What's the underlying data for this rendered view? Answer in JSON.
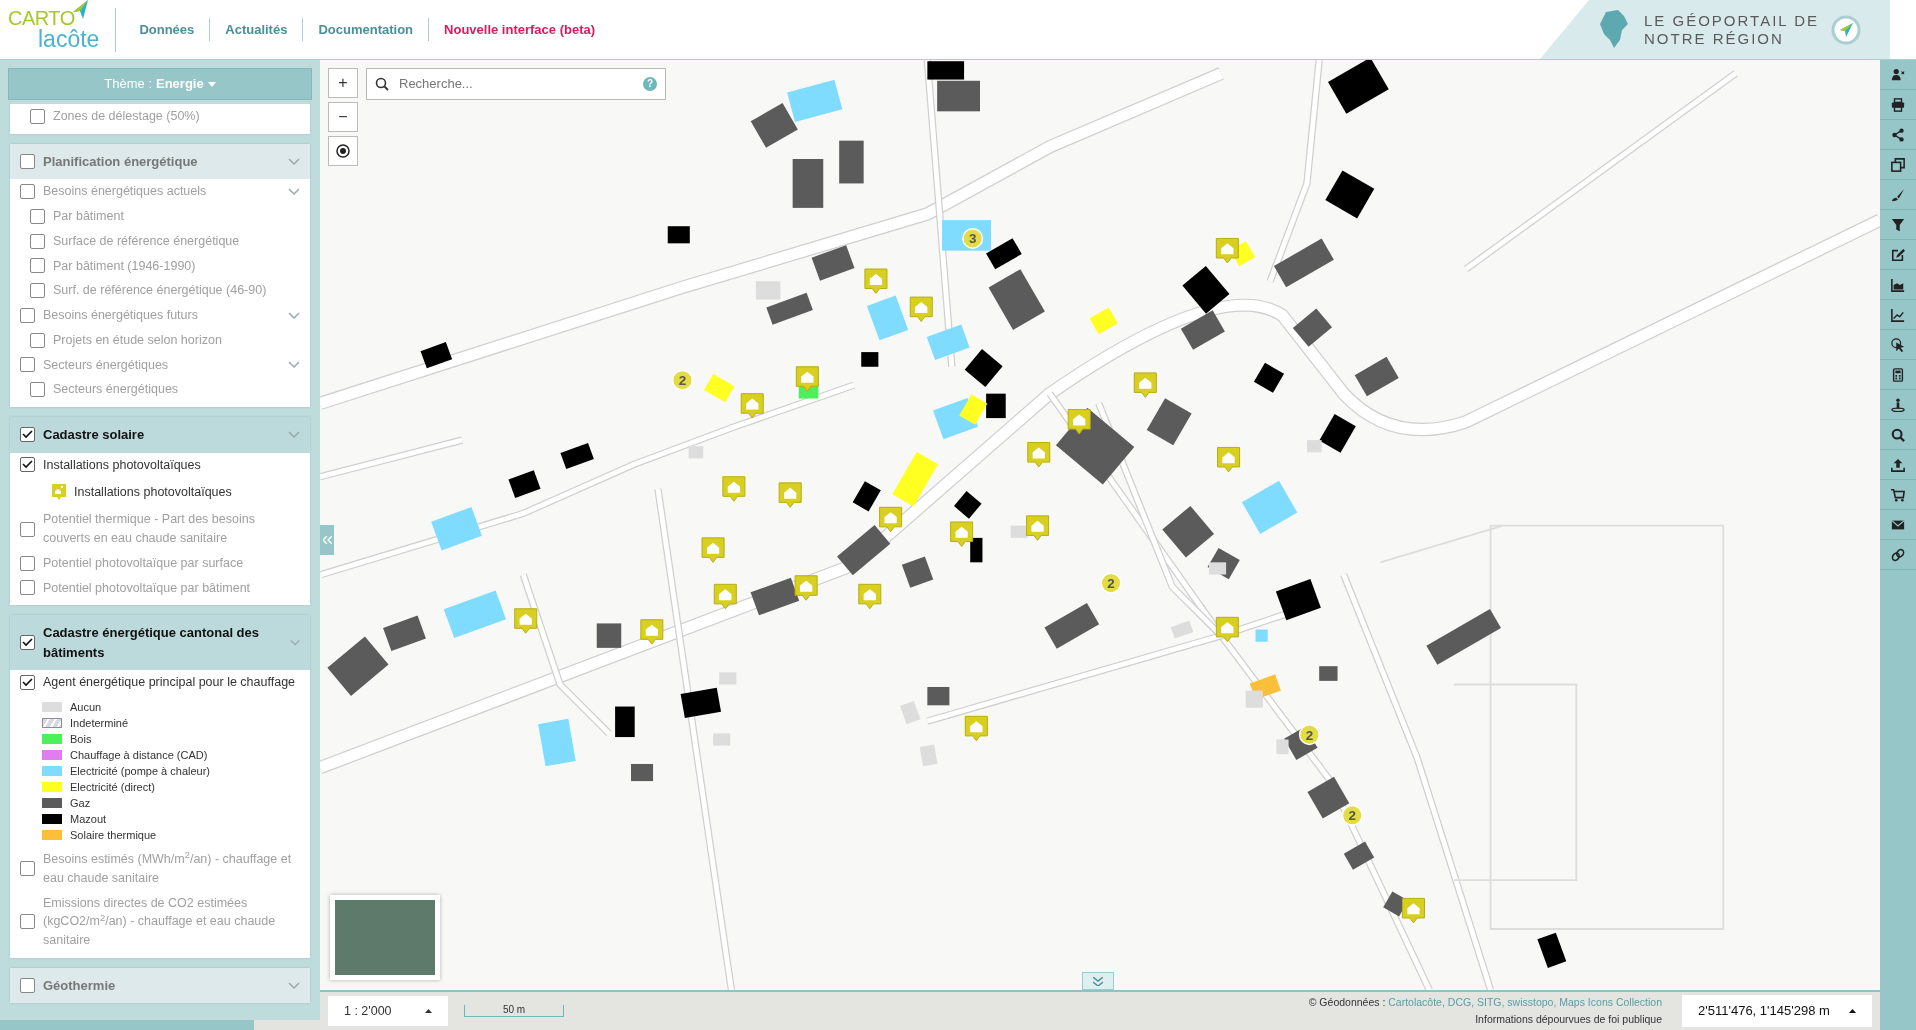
{
  "header": {
    "logo": {
      "line1": "CARTO",
      "line2": "lacôte"
    },
    "nav": [
      {
        "label": "Données",
        "kind": "normal"
      },
      {
        "label": "Actualités",
        "kind": "normal"
      },
      {
        "label": "Documentation",
        "kind": "normal"
      },
      {
        "label": "Nouvelle interface (beta)",
        "kind": "highlight"
      }
    ],
    "banner": [
      "LE GÉOPORTAIL DE",
      "NOTRE RÉGION"
    ]
  },
  "sidebar": {
    "theme": {
      "label": "Thème :",
      "value": "Energie"
    },
    "groups": [
      {
        "items": [
          {
            "label": "Zones de délestage (50%)",
            "checked": false
          }
        ]
      },
      {
        "title": "Planification énergétique",
        "checked": false,
        "items": [
          {
            "label": "Besoins énergétiques actuels",
            "checked": false,
            "children": [
              {
                "label": "Par bâtiment",
                "checked": false
              },
              {
                "label": "Surface de référence énergétique",
                "checked": false
              },
              {
                "label": "Par bâtiment (1946-1990)",
                "checked": false
              },
              {
                "label": "Surf. de référence énergétique (46-90)",
                "checked": false
              }
            ]
          },
          {
            "label": "Besoins énergétiques futurs",
            "checked": false,
            "children": [
              {
                "label": "Projets en étude selon horizon",
                "checked": false
              }
            ]
          },
          {
            "label": "Secteurs énergétiques",
            "checked": false,
            "children": [
              {
                "label": "Secteurs énergétiques",
                "checked": false
              }
            ]
          }
        ]
      },
      {
        "title": "Cadastre solaire",
        "checked": true,
        "items": [
          {
            "label": "Installations photovoltaïques",
            "checked": true,
            "legend": [
              {
                "label": "Installations photovoltaïques",
                "kind": "icon"
              }
            ]
          },
          {
            "label": "Potentiel thermique - Part des besoins couverts en eau chaude sanitaire",
            "checked": false
          },
          {
            "label": "Potentiel photovoltaïque par surface",
            "checked": false
          },
          {
            "label": "Potentiel photovoltaïque par bâtiment",
            "checked": false
          }
        ]
      },
      {
        "title": "Cadastre énergétique cantonal des bâtiments",
        "checked": true,
        "items": [
          {
            "label": "Agent énergétique principal pour le chauffage",
            "checked": true,
            "legend": [
              {
                "label": "Aucun",
                "kind": "swatch",
                "color": "#dddddd"
              },
              {
                "label": "Indeterminé",
                "kind": "hatch",
                "color": "#d8d8e4"
              },
              {
                "label": "Bois",
                "kind": "swatch",
                "color": "#4cf05a"
              },
              {
                "label": "Chauffage à distance (CAD)",
                "kind": "swatch",
                "color": "#e07ef0"
              },
              {
                "label": "Electricité (pompe à chaleur)",
                "kind": "swatch",
                "color": "#7fdcff"
              },
              {
                "label": "Electricité (direct)",
                "kind": "swatch",
                "color": "#ffff22"
              },
              {
                "label": "Gaz",
                "kind": "swatch",
                "color": "#5b5b5b"
              },
              {
                "label": "Mazout",
                "kind": "swatch",
                "color": "#000000"
              },
              {
                "label": "Solaire thermique",
                "kind": "swatch",
                "color": "#fbbf3a"
              }
            ]
          },
          {
            "label": "Besoins estimés (MWh/m$^{2}$/an) - chauffage et eau chaude sanitaire",
            "checked": false
          },
          {
            "label": "Emissions directes de CO2 estimées (kgCO2/m$^{2}$/an) - chauffage et eau chaude sanitaire",
            "checked": false
          }
        ]
      },
      {
        "title": "Géothermie",
        "checked": false
      }
    ]
  },
  "map": {
    "zoom_in": "+",
    "zoom_out": "−",
    "search": {
      "placeholder": "Recherche..."
    },
    "help": "?",
    "clusters": [
      {
        "count": "2"
      },
      {
        "count": "3"
      },
      {
        "count": "2"
      },
      {
        "count": "2"
      },
      {
        "count": "2"
      }
    ]
  },
  "footer": {
    "scale": "1 : 2'000",
    "scale_bar": "50 m",
    "attribution": {
      "prefix": "© Géodonnées :",
      "sources": [
        "Cartolacôte,",
        "DCG,",
        "SITG,",
        "swisstopo,",
        "Maps Icons Collection"
      ],
      "disclaimer": "Informations dépourvues de foi publique"
    },
    "coordinates": "2'511'476, 1'145'298 m"
  }
}
